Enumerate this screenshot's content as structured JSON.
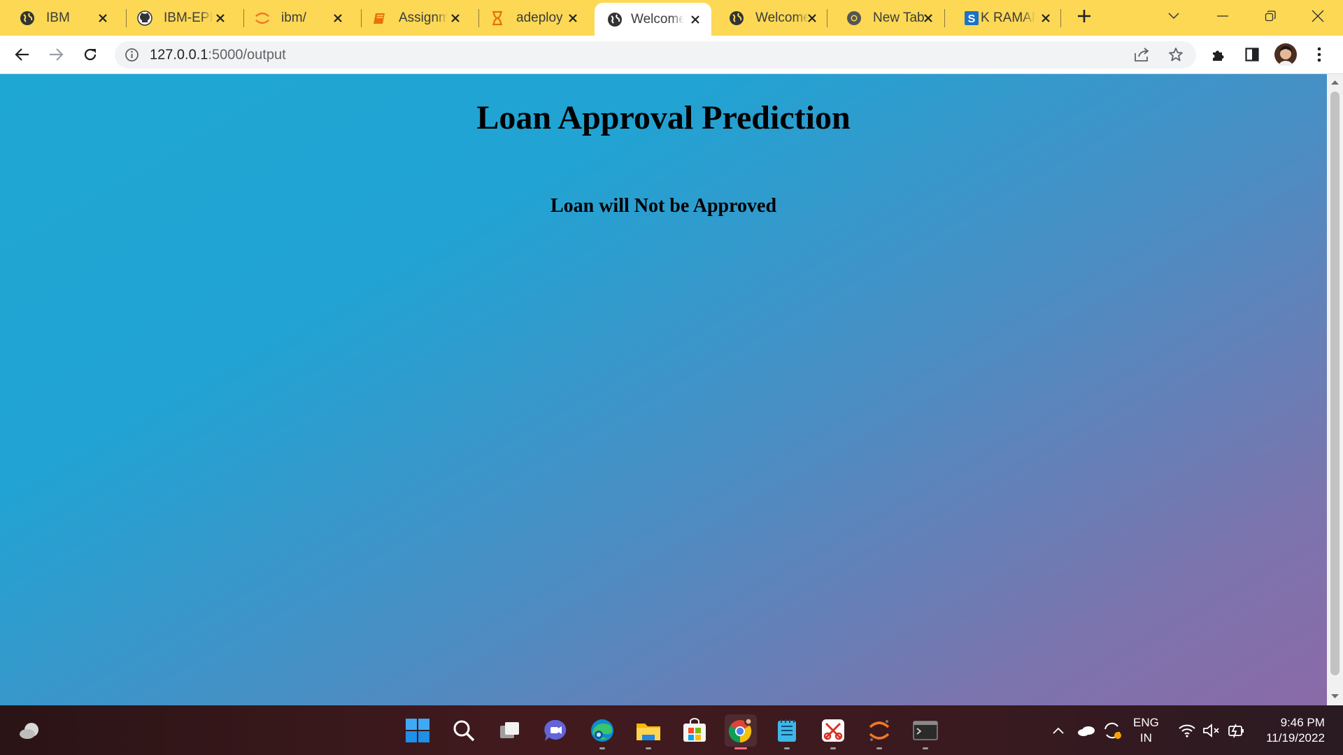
{
  "browser": {
    "tabs": [
      {
        "label": "IBM",
        "icon": "globe-icon",
        "active": false
      },
      {
        "label": "IBM-EPBL",
        "icon": "github-icon",
        "active": false
      },
      {
        "label": "ibm/",
        "icon": "jupyter-icon",
        "active": false
      },
      {
        "label": "Assignme",
        "icon": "book-icon",
        "active": false
      },
      {
        "label": "adeploy",
        "icon": "hourglass-icon",
        "active": false
      },
      {
        "label": "Welcome",
        "icon": "globe-icon",
        "active": true
      },
      {
        "label": "Welcome",
        "icon": "globe-icon",
        "active": false
      },
      {
        "label": "New Tab",
        "icon": "chrome-icon",
        "active": false
      },
      {
        "label": "K RAMAN",
        "icon": "s-icon",
        "active": false
      }
    ],
    "address": {
      "host": "127.0.0.1",
      "path": ":5000/output"
    }
  },
  "page": {
    "title": "Loan Approval Prediction",
    "result": "Loan will Not be Approved"
  },
  "taskbar": {
    "apps": [
      "start",
      "search",
      "task-view",
      "teams-chat",
      "edge",
      "file-explorer",
      "store",
      "chrome",
      "notepad",
      "snipping",
      "jupyter",
      "terminal"
    ],
    "language": {
      "line1": "ENG",
      "line2": "IN"
    },
    "clock": {
      "time": "9:46 PM",
      "date": "11/19/2022"
    }
  },
  "colors": {
    "tab_strip": "#fcd855",
    "page_gradient_start": "#1fa7d3",
    "page_gradient_end": "#8a6aa8"
  }
}
